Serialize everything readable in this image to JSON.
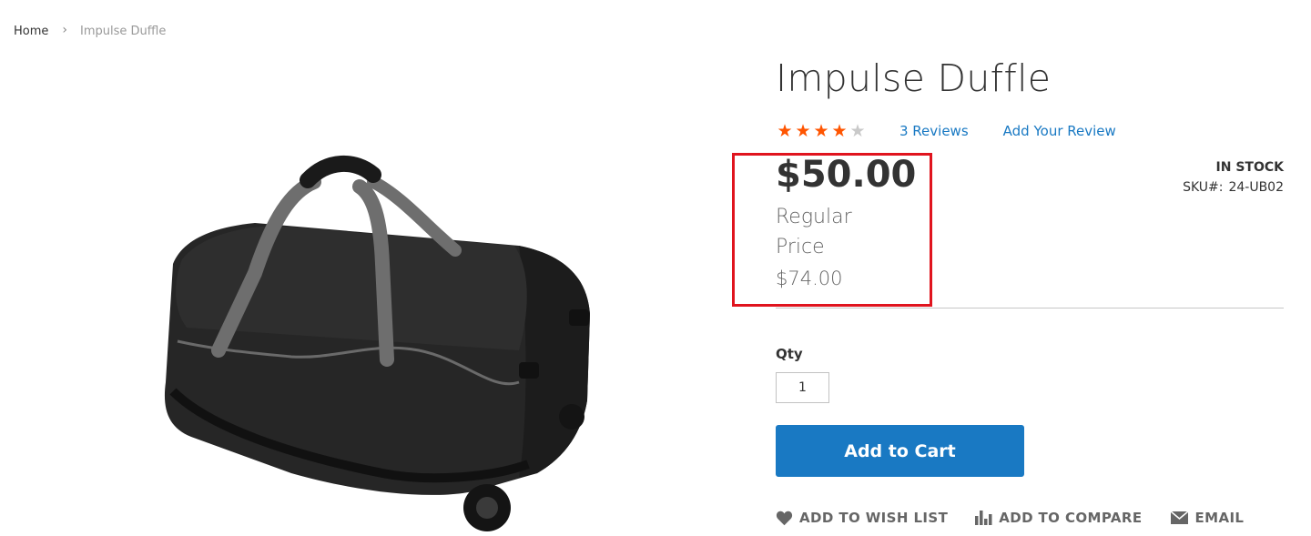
{
  "breadcrumb": {
    "home": "Home",
    "separator": "›",
    "current": "Impulse Duffle"
  },
  "product": {
    "title": "Impulse Duffle",
    "rating": {
      "value": 4,
      "max": 5,
      "filled_color": "#ff5501",
      "empty_color": "#c9c9c9"
    },
    "reviews_count_label": "3 Reviews",
    "add_review_label": "Add Your Review",
    "final_price": "$50.00",
    "regular_price_label": "Regular Price",
    "regular_price": "$74.00",
    "stock_status": "IN STOCK",
    "sku_label": "SKU#:",
    "sku": "24-UB02",
    "image_icon": "duffle-bag-photo"
  },
  "purchase": {
    "qty_label": "Qty",
    "qty_value": "1",
    "add_to_cart_label": "Add to Cart",
    "button_color": "#1979c3"
  },
  "actions": {
    "wishlist_label": "ADD TO WISH LIST",
    "wishlist_icon": "heart-icon",
    "compare_label": "ADD TO COMPARE",
    "compare_icon": "bar-chart-icon",
    "email_label": "EMAIL",
    "email_icon": "envelope-icon"
  },
  "highlight": {
    "color": "#e0141e"
  }
}
